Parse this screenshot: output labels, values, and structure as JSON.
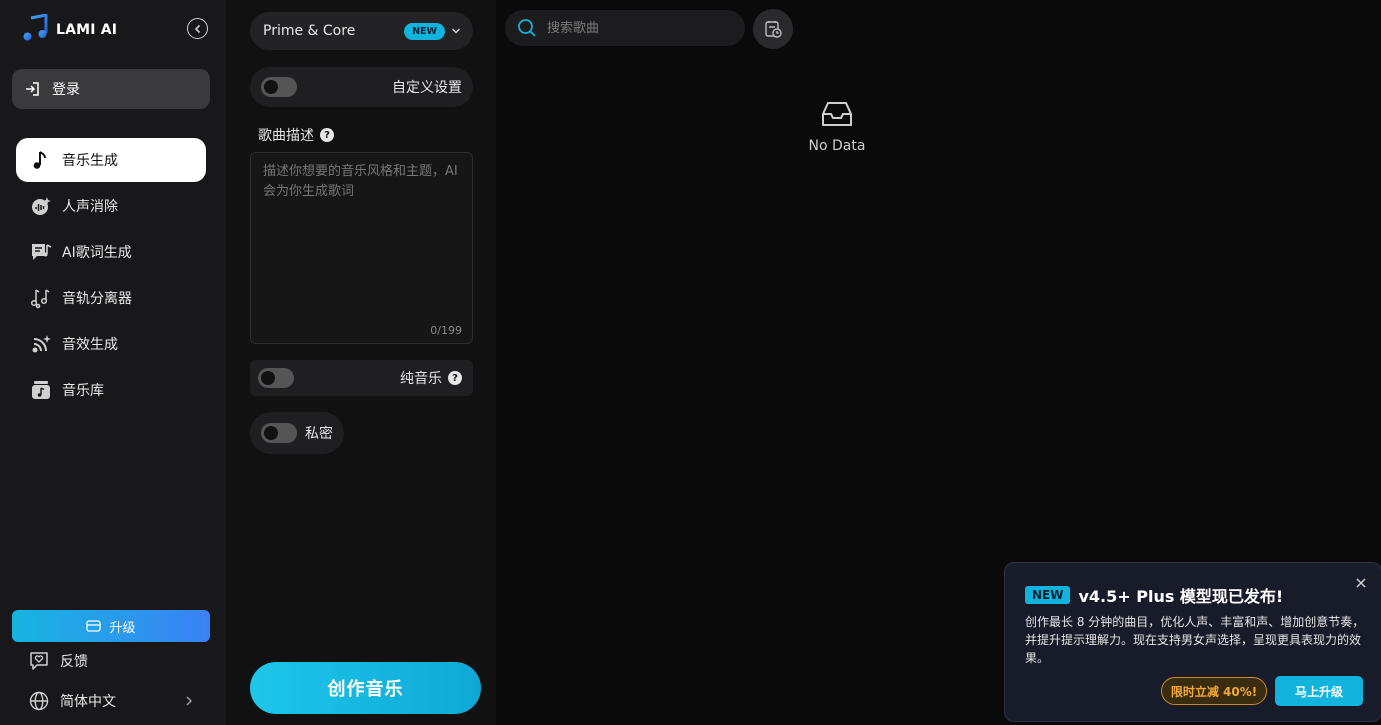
{
  "app": {
    "name": "LAMI AI"
  },
  "sidebar": {
    "login_label": "登录",
    "items": [
      {
        "label": "音乐生成",
        "icon": "music-note-icon",
        "active": true
      },
      {
        "label": "人声消除",
        "icon": "vocal-remove-icon",
        "active": false
      },
      {
        "label": "AI歌词生成",
        "icon": "lyrics-icon",
        "active": false
      },
      {
        "label": "音轨分离器",
        "icon": "track-split-icon",
        "active": false
      },
      {
        "label": "音效生成",
        "icon": "sound-effect-icon",
        "active": false
      },
      {
        "label": "音乐库",
        "icon": "music-library-icon",
        "active": false
      }
    ],
    "upgrade_label": "升级",
    "feedback_label": "反馈",
    "language_label": "简体中文"
  },
  "panel": {
    "model": {
      "name": "Prime & Core",
      "badge": "NEW"
    },
    "custom_settings_label": "自定义设置",
    "description_label": "歌曲描述",
    "description_placeholder": "描述你想要的音乐风格和主题，AI 会为你生成歌词",
    "description_value": "",
    "char_counter": "0/199",
    "instrumental_label": "纯音乐",
    "private_label": "私密",
    "create_label": "创作音乐"
  },
  "main": {
    "search_placeholder": "搜索歌曲",
    "empty_text": "No Data"
  },
  "popup": {
    "badge": "NEW",
    "title": "v4.5+ Plus 模型现已发布!",
    "body": "创作最长 8 分钟的曲目，优化人声、丰富和声、增加创意节奏，并提升提示理解力。现在支持男女声选择，呈现更具表现力的效果。",
    "discount_label": "限时立减 40%!",
    "upgrade_label": "马上升级"
  },
  "colors": {
    "accent": "#12b3dc",
    "discount": "#f0a83a"
  }
}
